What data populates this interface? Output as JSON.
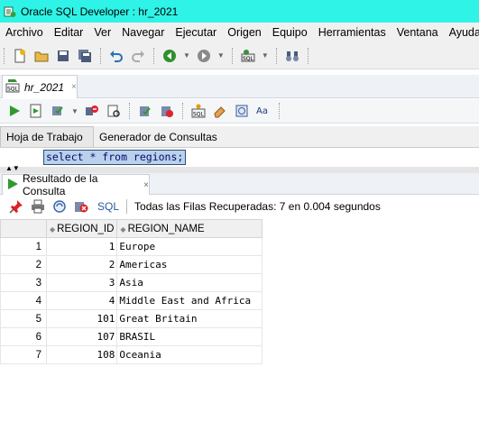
{
  "window": {
    "title": "Oracle SQL Developer : hr_2021"
  },
  "menu": [
    "Archivo",
    "Editar",
    "Ver",
    "Navegar",
    "Ejecutar",
    "Origen",
    "Equipo",
    "Herramientas",
    "Ventana",
    "Ayuda"
  ],
  "doc_tab": {
    "label": "hr_2021",
    "close": "×"
  },
  "sub_tabs": [
    "Hoja de Trabajo",
    "Generador de Consultas"
  ],
  "editor": {
    "sql": "select * from regions;"
  },
  "result_tab": {
    "label": "Resultado de la Consulta",
    "close": "×"
  },
  "result_toolbar": {
    "sql_label": "SQL",
    "status": "Todas las Filas Recuperadas: 7 en 0.004 segundos"
  },
  "grid": {
    "columns": [
      "REGION_ID",
      "REGION_NAME"
    ],
    "rows": [
      {
        "n": "1",
        "id": "1",
        "name": "Europe"
      },
      {
        "n": "2",
        "id": "2",
        "name": "Americas"
      },
      {
        "n": "3",
        "id": "3",
        "name": "Asia"
      },
      {
        "n": "4",
        "id": "4",
        "name": "Middle East and Africa"
      },
      {
        "n": "5",
        "id": "101",
        "name": "Great Britain"
      },
      {
        "n": "6",
        "id": "107",
        "name": "BRASIL"
      },
      {
        "n": "7",
        "id": "108",
        "name": "Oceania"
      }
    ]
  },
  "colors": {
    "titlebar": "#2ff3e6",
    "selection": "#b9d1ea",
    "sql_text": "#000a6e"
  }
}
